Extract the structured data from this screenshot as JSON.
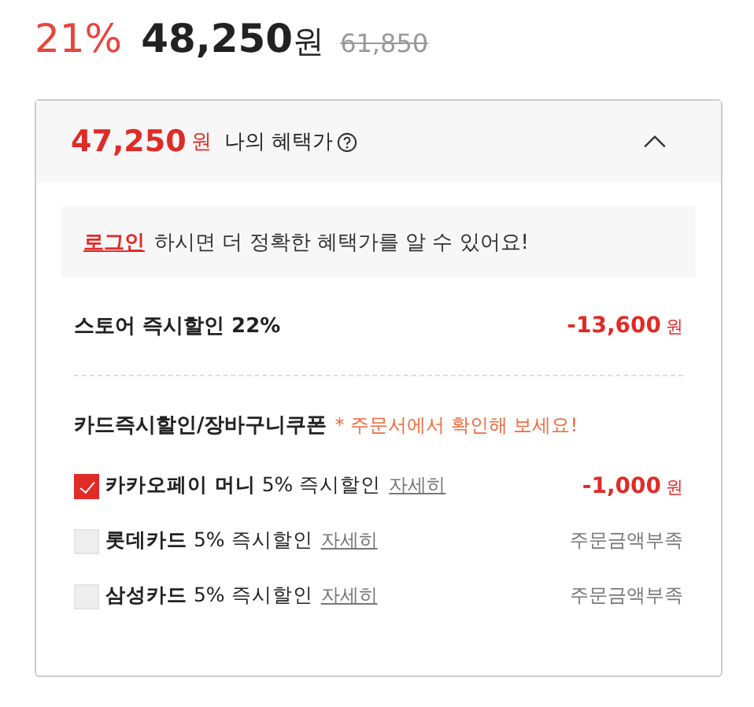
{
  "price": {
    "discount_rate": "21%",
    "amount": "48,250",
    "unit": "원",
    "original": "61,850"
  },
  "benefit": {
    "amount": "47,250",
    "unit": "원",
    "label": "나의 혜택가",
    "expanded": true,
    "notice": {
      "link": "로그인",
      "text": "하시면 더 정확한 혜택가를 알 수 있어요!"
    },
    "store_discount": {
      "label": "스토어 즉시할인 22%",
      "amount": "-13,600",
      "unit": "원"
    },
    "card_section": {
      "title": "카드즉시할인/장바구니쿠폰",
      "note": "* 주문서에서 확인해 보세요!"
    },
    "cards": [
      {
        "label": "**카카오페이 머니** 5% 즉시할인",
        "link": "자세히",
        "checked": true,
        "kind": "amount",
        "amount": "-1,000",
        "unit": "원"
      },
      {
        "label": "**롯데카드** 5% 즉시할인",
        "link": "자세히",
        "checked": false,
        "kind": "status",
        "status": "주문금액부족"
      },
      {
        "label": "**삼성카드** 5% 즉시할인",
        "link": "자세히",
        "checked": false,
        "kind": "status",
        "status": "주문금액부족"
      }
    ]
  }
}
